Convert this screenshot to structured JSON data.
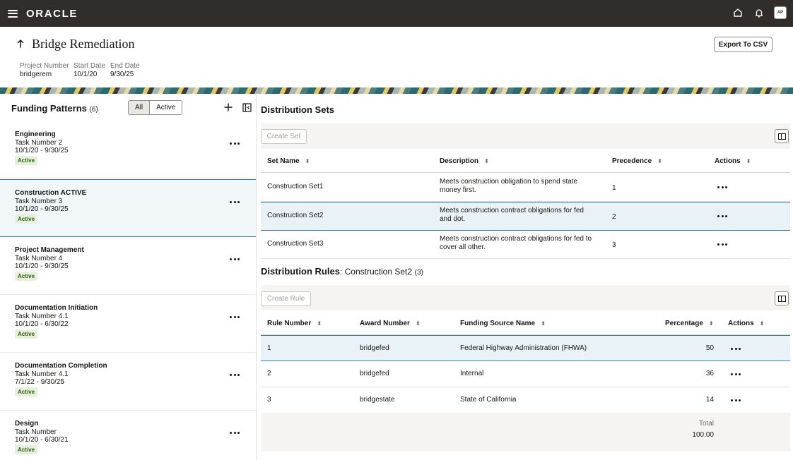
{
  "app": {
    "brand": "ORACLE",
    "avatar_initials": "AP"
  },
  "header": {
    "title": "Bridge Remediation",
    "export_label": "Export To CSV",
    "project_number_label": "Project Number",
    "project_number": "bridgerem",
    "start_date_label": "Start Date",
    "start_date": "10/1/20",
    "end_date_label": "End Date",
    "end_date": "9/30/25"
  },
  "funding_patterns": {
    "title": "Funding Patterns",
    "count": "(6)",
    "filter_all": "All",
    "filter_active": "Active",
    "items": [
      {
        "name": "Engineering",
        "task": "Task Number 2",
        "dates": "10/1/20 - 9/30/25",
        "status": "Active"
      },
      {
        "name": "Construction ACTIVE",
        "task": "Task Number 3",
        "dates": "10/1/20 - 9/30/25",
        "status": "Active"
      },
      {
        "name": "Project Management",
        "task": "Task Number 4",
        "dates": "10/1/20 - 9/30/25",
        "status": "Active"
      },
      {
        "name": "Documentation Initiation",
        "task": "Task Number 4.1",
        "dates": "10/1/20 - 6/30/22",
        "status": "Active"
      },
      {
        "name": "Documentation Completion",
        "task": "Task Number 4.1",
        "dates": "7/1/22 - 9/30/25",
        "status": "Active"
      },
      {
        "name": "Design",
        "task": "Task Number",
        "dates": "10/1/20 - 6/30/21",
        "status": "Active"
      }
    ]
  },
  "distribution_sets": {
    "title": "Distribution Sets",
    "create_label": "Create Set",
    "columns": [
      "Set Name",
      "Description",
      "Precedence",
      "Actions"
    ],
    "rows": [
      {
        "name": "Construction Set1",
        "description": "Meets construction obligation to spend state money first.",
        "precedence": "1"
      },
      {
        "name": "Construction Set2",
        "description": "Meets construction contract obligations for fed and dot.",
        "precedence": "2"
      },
      {
        "name": "Construction Set3",
        "description": "Meets construction contract obligations for fed to cover all other.",
        "precedence": "3"
      }
    ]
  },
  "distribution_rules": {
    "title": "Distribution Rules",
    "subtitle": ": Construction Set2",
    "count": "(3)",
    "create_label": "Create Rule",
    "columns": [
      "Rule Number",
      "Award Number",
      "Funding Source Name",
      "Percentage",
      "Actions"
    ],
    "rows": [
      {
        "rule": "1",
        "award": "bridgefed",
        "source": "Federal Highway Administration (FHWA)",
        "percentage": "50"
      },
      {
        "rule": "2",
        "award": "bridgefed",
        "source": "Internal",
        "percentage": "36"
      },
      {
        "rule": "3",
        "award": "bridgestate",
        "source": "State of California",
        "percentage": "14"
      }
    ],
    "total_label": "Total",
    "total_value": "100.00"
  }
}
